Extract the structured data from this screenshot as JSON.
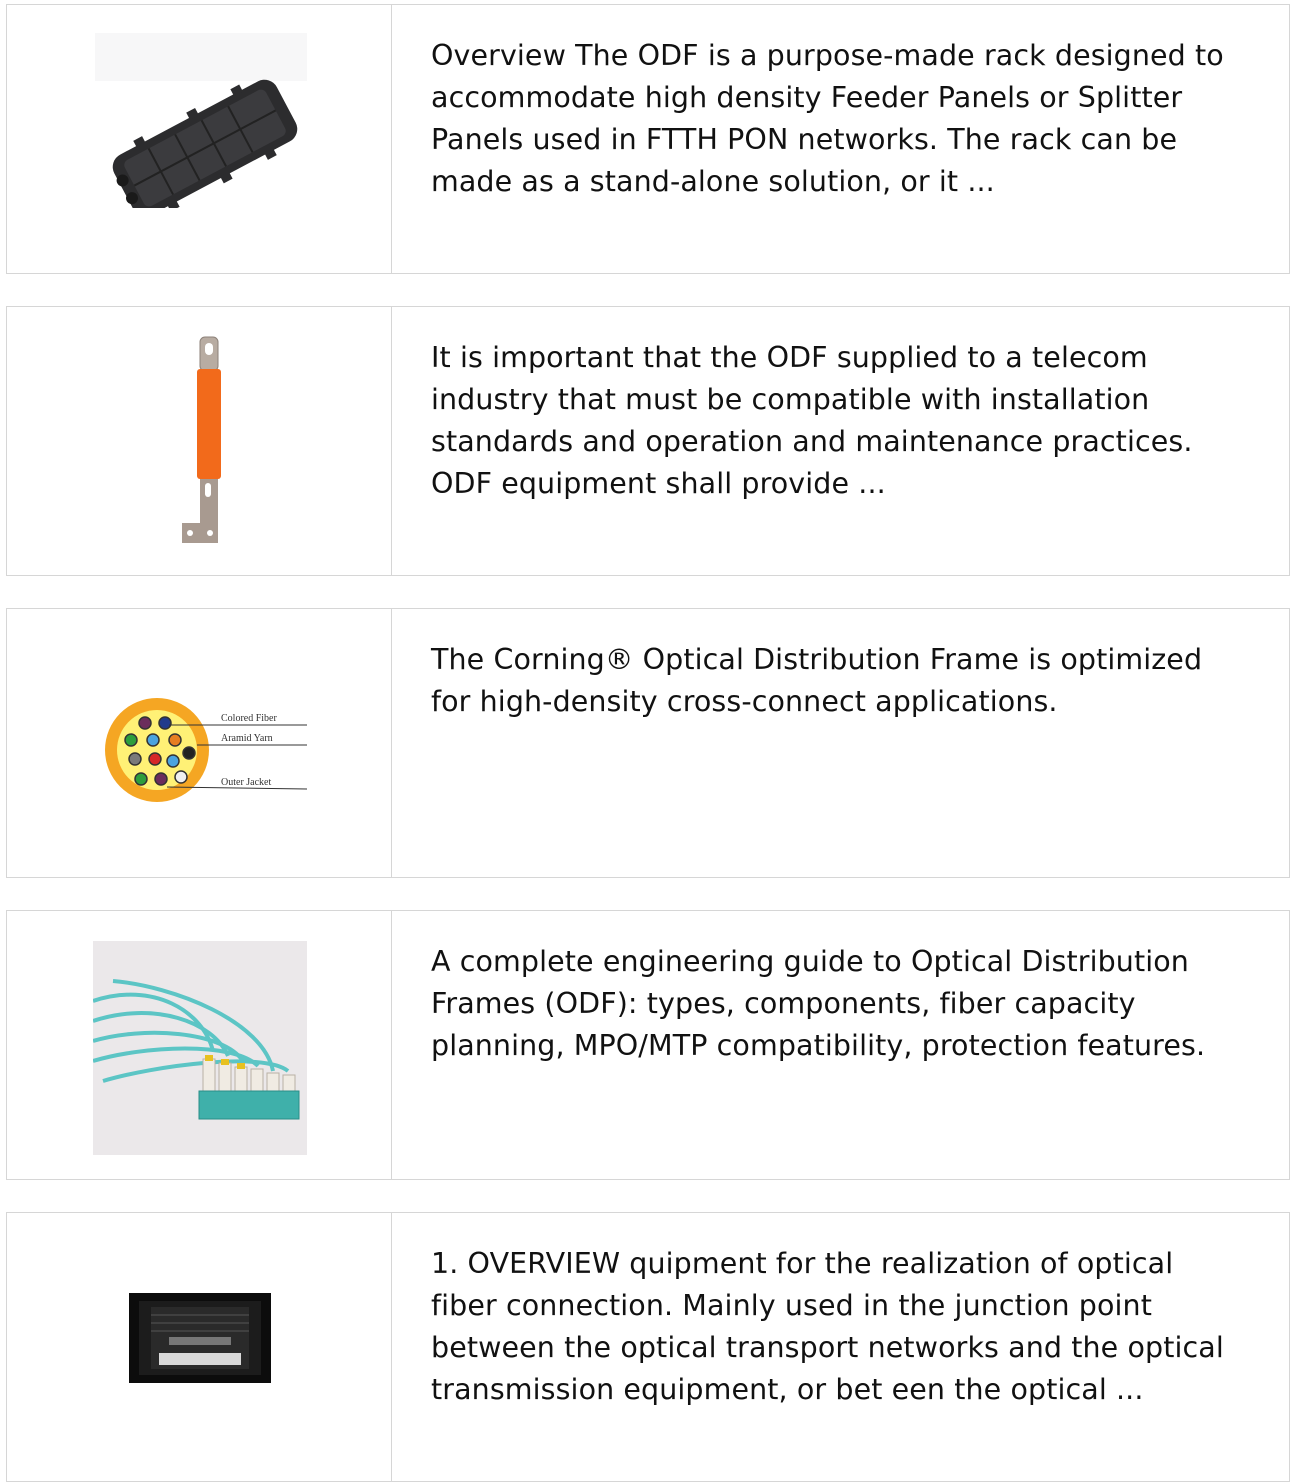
{
  "items": [
    {
      "icon": "fiber-closure-icon",
      "text": "Overview The ODF is a purpose-made rack designed to accommodate high density Feeder Panels or Splitter Panels used in FTTH PON networks. The rack can be made as a stand-alone solution, or it ..."
    },
    {
      "icon": "grounding-bar-icon",
      "text": "It is important that the ODF supplied to a telecom industry that must be compatible with installation standards and operation and maintenance practices. ODF equipment shall provide ..."
    },
    {
      "icon": "fiber-cable-cross-section-icon",
      "text": "The Corning® Optical Distribution Frame is optimized for high-density cross-connect applications.",
      "diagram_labels": [
        "Colored Fiber",
        "Aramid Yarn",
        "Outer Jacket"
      ]
    },
    {
      "icon": "lc-patch-cords-icon",
      "text": "A complete engineering guide to Optical Distribution Frames (ODF): types, components, fiber capacity planning, MPO/MTP compatibility, protection features."
    },
    {
      "icon": "network-cabinet-icon",
      "text": "1. OVERVIEW quipment for the realization of optical fiber connection. Mainly used in the junction point between the optical transport networks and the optical transmission equipment, or bet een the optical ..."
    }
  ],
  "colors": {
    "border": "#d6d6d6",
    "text": "#111111",
    "fiber_jacket": "#f5a623",
    "patch_cord": "#5cc5c5",
    "grounding_sleeve": "#f26a1b"
  }
}
